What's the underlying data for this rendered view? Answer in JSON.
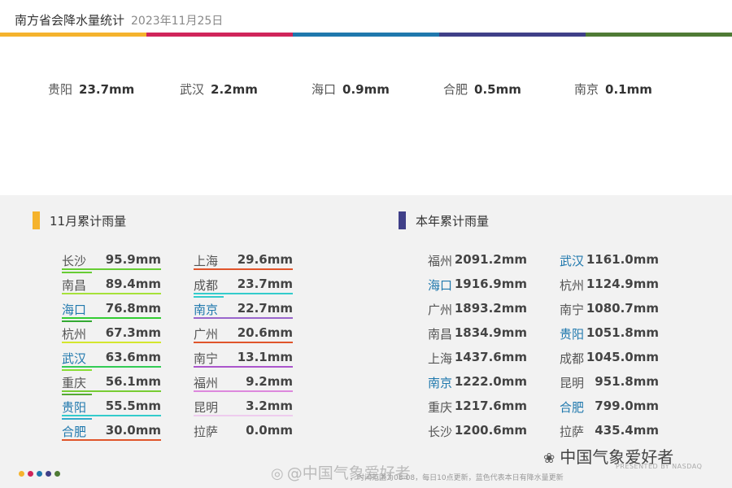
{
  "header": {
    "title": "南方省会降水量统计",
    "date": "2023年11月25日",
    "color_bar": [
      "#f5b32d",
      "#d0255a",
      "#1f78ad",
      "#3f3f88",
      "#4f7b35"
    ]
  },
  "daily": [
    {
      "city": "贵阳",
      "value": "23.7mm"
    },
    {
      "city": "武汉",
      "value": "2.2mm"
    },
    {
      "city": "海口",
      "value": "0.9mm"
    },
    {
      "city": "合肥",
      "value": "0.5mm"
    },
    {
      "city": "南京",
      "value": "0.1mm"
    }
  ],
  "november": {
    "title": "11月累计雨量",
    "marker_color": "#f5b32d",
    "col1": [
      {
        "city": "长沙",
        "value": "95.9mm",
        "highlight": false,
        "lines": [
          "#66cc33",
          "#66cc33"
        ]
      },
      {
        "city": "南昌",
        "value": "89.4mm",
        "highlight": false,
        "lines": [
          "#a6e23a"
        ]
      },
      {
        "city": "海口",
        "value": "76.8mm",
        "highlight": true,
        "lines": [
          "#33cc33",
          "#33aa33"
        ]
      },
      {
        "city": "杭州",
        "value": "67.3mm",
        "highlight": false,
        "lines": [
          "#d4e62e"
        ]
      },
      {
        "city": "武汉",
        "value": "63.6mm",
        "highlight": true,
        "lines": [
          "#33cc55",
          "#88dd33"
        ]
      },
      {
        "city": "重庆",
        "value": "56.1mm",
        "highlight": false,
        "lines": [
          "#77cc33",
          "#55aa33"
        ]
      },
      {
        "city": "贵阳",
        "value": "55.5mm",
        "highlight": true,
        "lines": [
          "#33cccc",
          "#33aacc"
        ]
      },
      {
        "city": "合肥",
        "value": "30.0mm",
        "highlight": true,
        "lines": [
          "#e0552b"
        ]
      }
    ],
    "col2": [
      {
        "city": "上海",
        "value": "29.6mm",
        "highlight": false,
        "lines": [
          "#e0552b"
        ]
      },
      {
        "city": "成都",
        "value": "23.7mm",
        "highlight": false,
        "lines": [
          "#33cccc",
          "#33cccc"
        ]
      },
      {
        "city": "南京",
        "value": "22.7mm",
        "highlight": true,
        "lines": [
          "#9966cc"
        ]
      },
      {
        "city": "广州",
        "value": "20.6mm",
        "highlight": false,
        "lines": [
          "#e0552b"
        ]
      },
      {
        "city": "南宁",
        "value": "13.1mm",
        "highlight": false,
        "lines": [
          "#aa55cc"
        ]
      },
      {
        "city": "福州",
        "value": "9.2mm",
        "highlight": false,
        "lines": [
          "#dd88dd"
        ]
      },
      {
        "city": "昆明",
        "value": "3.2mm",
        "highlight": false,
        "lines": [
          "#eeccee"
        ]
      },
      {
        "city": "拉萨",
        "value": "0.0mm",
        "highlight": false,
        "lines": []
      }
    ]
  },
  "year": {
    "title": "本年累计雨量",
    "marker_color": "#3f3f88",
    "col1": [
      {
        "city": "福州",
        "value": "2091.2mm",
        "highlight": false
      },
      {
        "city": "海口",
        "value": "1916.9mm",
        "highlight": true
      },
      {
        "city": "广州",
        "value": "1893.2mm",
        "highlight": false
      },
      {
        "city": "南昌",
        "value": "1834.9mm",
        "highlight": false
      },
      {
        "city": "上海",
        "value": "1437.6mm",
        "highlight": false
      },
      {
        "city": "南京",
        "value": "1222.0mm",
        "highlight": true
      },
      {
        "city": "重庆",
        "value": "1217.6mm",
        "highlight": false
      },
      {
        "city": "长沙",
        "value": "1200.6mm",
        "highlight": false
      }
    ],
    "col2": [
      {
        "city": "武汉",
        "value": "1161.0mm",
        "highlight": true
      },
      {
        "city": "杭州",
        "value": "1124.9mm",
        "highlight": false
      },
      {
        "city": "南宁",
        "value": "1080.7mm",
        "highlight": false
      },
      {
        "city": "贵阳",
        "value": "1051.8mm",
        "highlight": true
      },
      {
        "city": "成都",
        "value": "1045.0mm",
        "highlight": false
      },
      {
        "city": "昆明",
        "value": "951.8mm",
        "highlight": false
      },
      {
        "city": "合肥",
        "value": "799.0mm",
        "highlight": true
      },
      {
        "city": "拉萨",
        "value": "435.4mm",
        "highlight": false
      }
    ]
  },
  "highlight_color": "#1f78ad",
  "city_color": "#555555",
  "footer": {
    "dots": [
      "#f5b32d",
      "#d0255a",
      "#1f78ad",
      "#3f3f88",
      "#4f7b35"
    ],
    "note": "，时间范围为08-08，每日10点更新，蓝色代表本日有降水量更新",
    "watermark_weibo": "@中国气象爱好者",
    "watermark_wechat": "中国气象爱好者",
    "presented": "PRESENTED BY NASDAQ"
  }
}
